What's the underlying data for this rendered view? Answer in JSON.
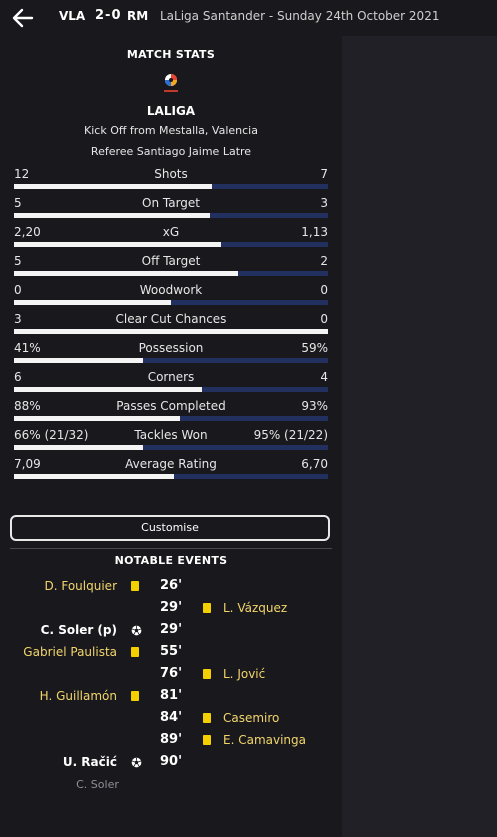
{
  "header": {
    "home_abbr": "VLA",
    "score": "2-0",
    "away_abbr": "RM",
    "competition_date": "LaLiga Santander  -  Sunday 24th October 2021"
  },
  "match_stats": {
    "title": "MATCH STATS",
    "league": "LALIGA",
    "kickoff": "Kick Off from Mestalla, Valencia",
    "referee": "Referee  Santiago Jaime Latre"
  },
  "stats": [
    {
      "label": "Shots",
      "home": "12",
      "away": "7",
      "home_share": 0.63
    },
    {
      "label": "On Target",
      "home": "5",
      "away": "3",
      "home_share": 0.625
    },
    {
      "label": "xG",
      "home": "2,20",
      "away": "1,13",
      "home_share": 0.66
    },
    {
      "label": "Off Target",
      "home": "5",
      "away": "2",
      "home_share": 0.714
    },
    {
      "label": "Woodwork",
      "home": "0",
      "away": "0",
      "home_share": 0.5
    },
    {
      "label": "Clear Cut Chances",
      "home": "3",
      "away": "0",
      "home_share": 1.0
    },
    {
      "label": "Possession",
      "home": "41%",
      "away": "59%",
      "home_share": 0.41
    },
    {
      "label": "Corners",
      "home": "6",
      "away": "4",
      "home_share": 0.6
    },
    {
      "label": "Passes Completed",
      "home": "88%",
      "away": "93%",
      "home_share": 0.53
    },
    {
      "label": "Tackles Won",
      "home": "66% (21/32)",
      "away": "95% (21/22)",
      "home_share": 0.41
    },
    {
      "label": "Average Rating",
      "home": "7,09",
      "away": "6,70",
      "home_share": 0.51
    }
  ],
  "customise_label": "Customise",
  "events_title": "NOTABLE EVENTS",
  "events": [
    {
      "minute": "26'",
      "home": "D. Foulquier",
      "away": "",
      "home_icon": "yellow-card",
      "away_icon": ""
    },
    {
      "minute": "29'",
      "home": "",
      "away": "L. Vázquez",
      "home_icon": "",
      "away_icon": "yellow-card"
    },
    {
      "minute": "29'",
      "home": "C. Soler (p)",
      "away": "",
      "home_icon": "goal",
      "away_icon": "",
      "goal": true
    },
    {
      "minute": "55'",
      "home": "Gabriel Paulista",
      "away": "",
      "home_icon": "yellow-card",
      "away_icon": ""
    },
    {
      "minute": "76'",
      "home": "",
      "away": "L. Jović",
      "home_icon": "",
      "away_icon": "yellow-card"
    },
    {
      "minute": "81'",
      "home": "H. Guillamón",
      "away": "",
      "home_icon": "yellow-card",
      "away_icon": ""
    },
    {
      "minute": "84'",
      "home": "",
      "away": "Casemiro",
      "home_icon": "",
      "away_icon": "yellow-card"
    },
    {
      "minute": "89'",
      "home": "",
      "away": "E. Camavinga",
      "home_icon": "",
      "away_icon": "yellow-card"
    },
    {
      "minute": "90'",
      "home": "U. Račić",
      "away": "",
      "home_icon": "goal",
      "away_icon": "",
      "goal": true
    }
  ],
  "assist_note": "C. Soler",
  "colors": {
    "accent_card": "#f5d000",
    "bar_home": "#f4f4f4",
    "bar_away": "#21305f",
    "event_name": "#f2d66b"
  }
}
